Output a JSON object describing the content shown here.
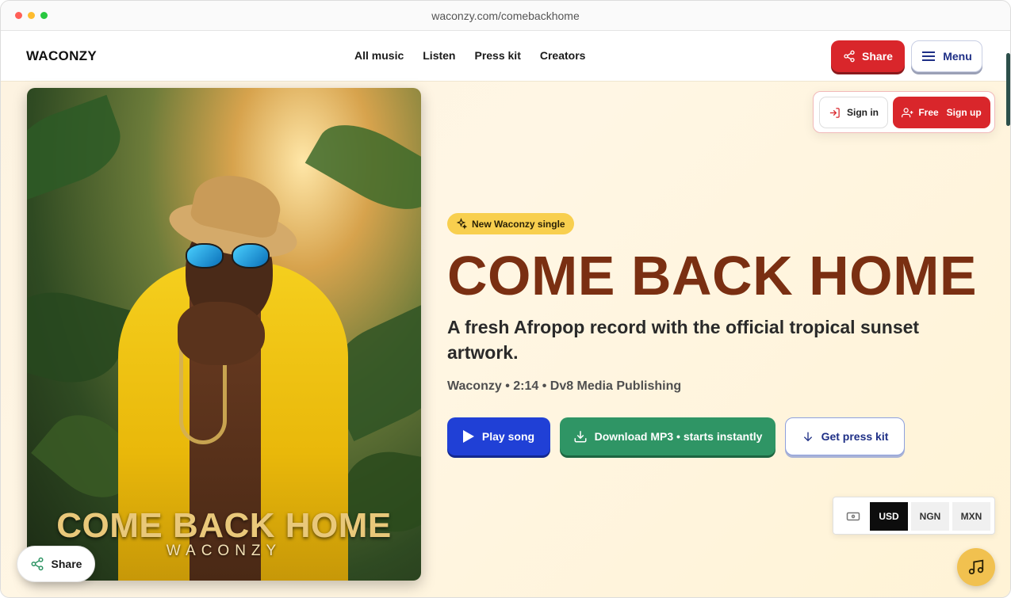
{
  "browser": {
    "url": "waconzy.com/comebackhome"
  },
  "header": {
    "logo": "WACONZY",
    "nav": [
      "All music",
      "Listen",
      "Press kit",
      "Creators"
    ],
    "share_label": "Share",
    "menu_label": "Menu"
  },
  "auth": {
    "signin_label": "Sign in",
    "signup_word1": "Free",
    "signup_word2": "Sign up"
  },
  "art": {
    "title": "COME BACK HOME",
    "artist": "WACONZY"
  },
  "hero": {
    "badge": "New Waconzy single",
    "title": "COME BACK HOME",
    "subtitle": "A fresh Afropop record with the official tropical sunset artwork.",
    "meta": "Waconzy • 2:14 • Dv8 Media Publishing",
    "play_label": "Play song",
    "download_label": "Download MP3 • starts instantly",
    "presskit_label": "Get press kit"
  },
  "share_float": {
    "label": "Share"
  },
  "currency": {
    "options": [
      "USD",
      "NGN",
      "MXN"
    ],
    "selected": "USD"
  },
  "colors": {
    "brand_red": "#d9262b",
    "title_brown": "#7a2f12",
    "play_blue": "#2040d6",
    "download_green": "#2f9565",
    "badge_yellow": "#f8cf4e"
  }
}
